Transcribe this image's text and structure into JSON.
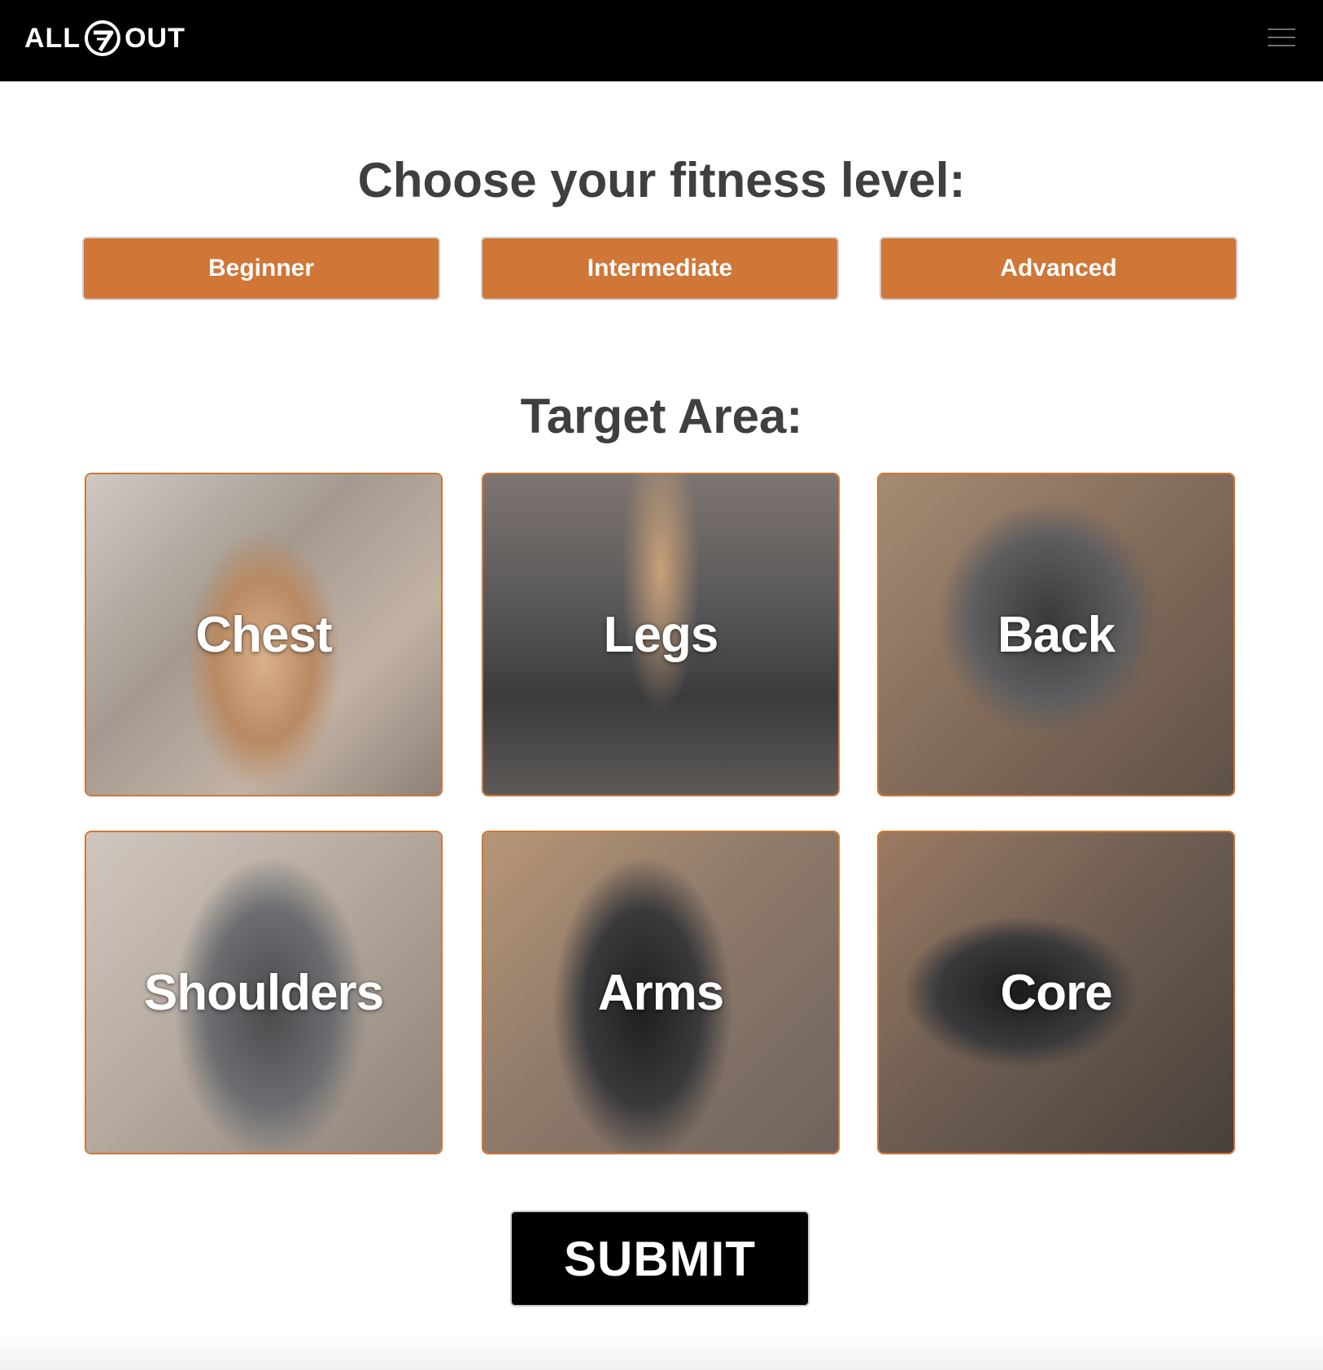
{
  "header": {
    "logo": {
      "left": "ALL",
      "right": "OUT"
    },
    "menu_icon": "hamburger-menu-icon"
  },
  "level": {
    "title": "Choose your fitness level:",
    "options": [
      "Beginner",
      "Intermediate",
      "Advanced"
    ]
  },
  "target": {
    "title": "Target Area:",
    "areas": [
      "Chest",
      "Legs",
      "Back",
      "Shoulders",
      "Arms",
      "Core"
    ]
  },
  "submit_label": "SUBMIT",
  "colors": {
    "accent": "#d07637",
    "header_bg": "#000000",
    "heading_text": "#3f3f3f"
  }
}
